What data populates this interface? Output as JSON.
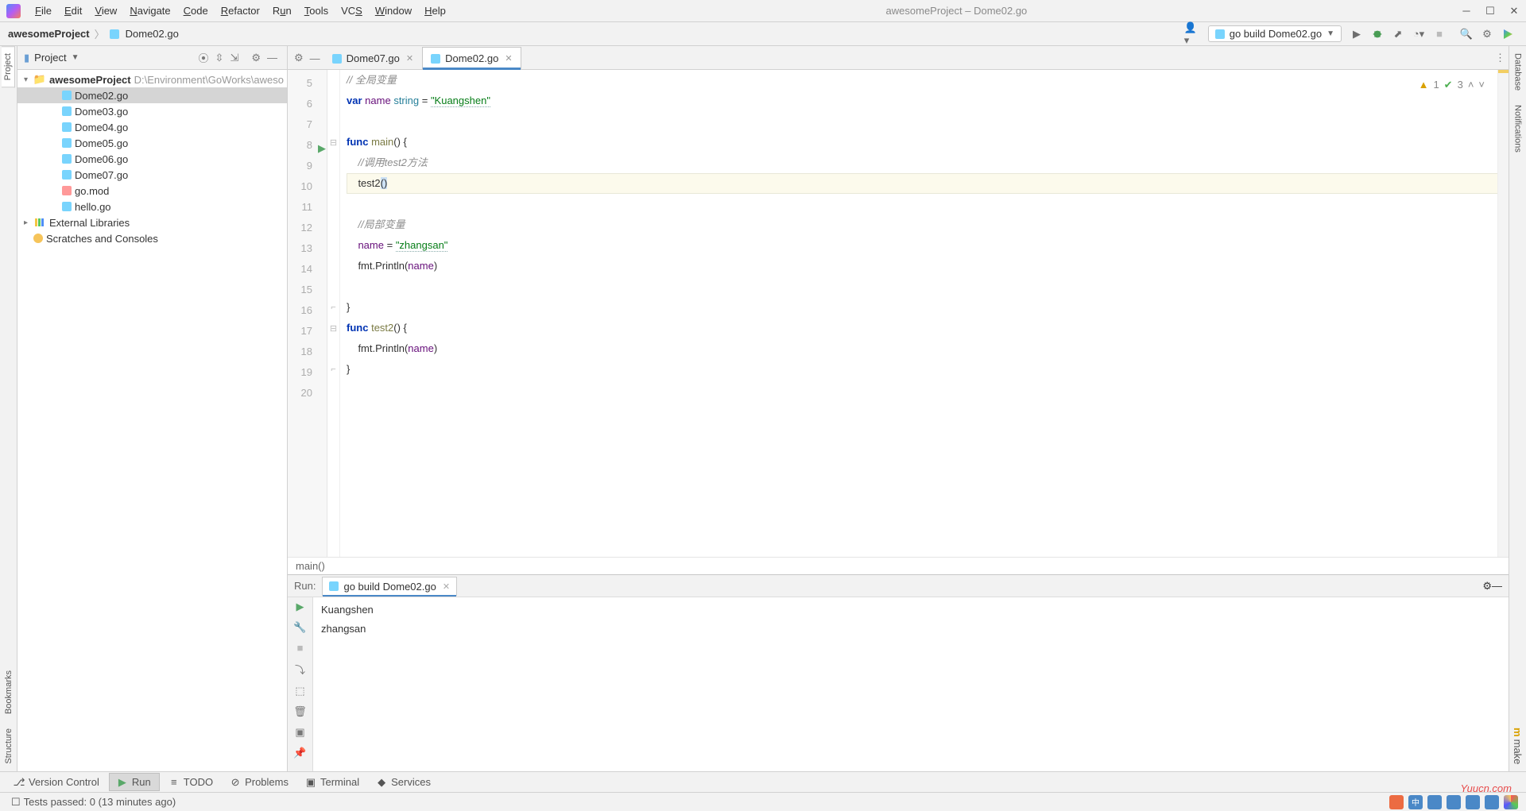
{
  "window": {
    "title": "awesomeProject – Dome02.go"
  },
  "menu": {
    "file": "File",
    "edit": "Edit",
    "view": "View",
    "navigate": "Navigate",
    "code": "Code",
    "refactor": "Refactor",
    "run": "Run",
    "tools": "Tools",
    "vcs": "VCS",
    "window": "Window",
    "help": "Help"
  },
  "breadcrumb": {
    "project": "awesomeProject",
    "file": "Dome02.go"
  },
  "run_config": {
    "label": "go build Dome02.go"
  },
  "project_panel": {
    "title": "Project",
    "root": {
      "name": "awesomeProject",
      "path": "D:\\Environment\\GoWorks\\aweso"
    },
    "files": [
      "Dome02.go",
      "Dome03.go",
      "Dome04.go",
      "Dome05.go",
      "Dome06.go",
      "Dome07.go",
      "go.mod",
      "hello.go"
    ],
    "ext_libs": "External Libraries",
    "scratches": "Scratches and Consoles",
    "selected": "Dome02.go"
  },
  "editor": {
    "tabs": [
      {
        "name": "Dome07.go",
        "active": false
      },
      {
        "name": "Dome02.go",
        "active": true
      }
    ],
    "warnings": "1",
    "hints": "3",
    "lines": [
      {
        "n": 5,
        "html": "<span class='cm'>// 全局变量</span>"
      },
      {
        "n": 6,
        "html": "<span class='kw'>var</span> <span class='id'>name</span> <span class='ty'>string</span> = <span class='str u'>\"Kuangshen\"</span>"
      },
      {
        "n": 7,
        "html": ""
      },
      {
        "n": 8,
        "html": "<span class='kw'>func</span> <span class='fn'>main</span>() {",
        "run": true,
        "fold": true
      },
      {
        "n": 9,
        "html": "    <span class='cm'>//调用test2方法</span>"
      },
      {
        "n": 10,
        "html": "    test2<span class='caret-sel'>()</span>",
        "current": true
      },
      {
        "n": 11,
        "html": ""
      },
      {
        "n": 12,
        "html": "    <span class='cm'>//局部变量</span>"
      },
      {
        "n": 13,
        "html": "    <span class='id'>name</span> = <span class='str u'>\"zhangsan\"</span>"
      },
      {
        "n": 14,
        "html": "    fmt.Println(<span class='id'>name</span>)"
      },
      {
        "n": 15,
        "html": ""
      },
      {
        "n": 16,
        "html": "}",
        "foldend": true
      },
      {
        "n": 17,
        "html": "<span class='kw'>func</span> <span class='fn'>test2</span>() {",
        "fold": true
      },
      {
        "n": 18,
        "html": "    fmt.Println(<span class='id'>name</span>)"
      },
      {
        "n": 19,
        "html": "}",
        "foldend": true
      },
      {
        "n": 20,
        "html": ""
      }
    ],
    "breadcrumb": "main()"
  },
  "run_panel": {
    "label": "Run:",
    "tab": "go build Dome02.go",
    "output": [
      "Kuangshen",
      "zhangsan"
    ]
  },
  "bottom_tabs": {
    "version_control": "Version Control",
    "run": "Run",
    "todo": "TODO",
    "problems": "Problems",
    "terminal": "Terminal",
    "services": "Services"
  },
  "statusbar": {
    "msg": "Tests passed: 0 (13 minutes ago)"
  },
  "left_tabs": {
    "project": "Project",
    "bookmarks": "Bookmarks",
    "structure": "Structure"
  },
  "right_tabs": {
    "database": "Database",
    "notifications": "Notifications",
    "make": "make"
  },
  "watermark": "Yuucn.com"
}
